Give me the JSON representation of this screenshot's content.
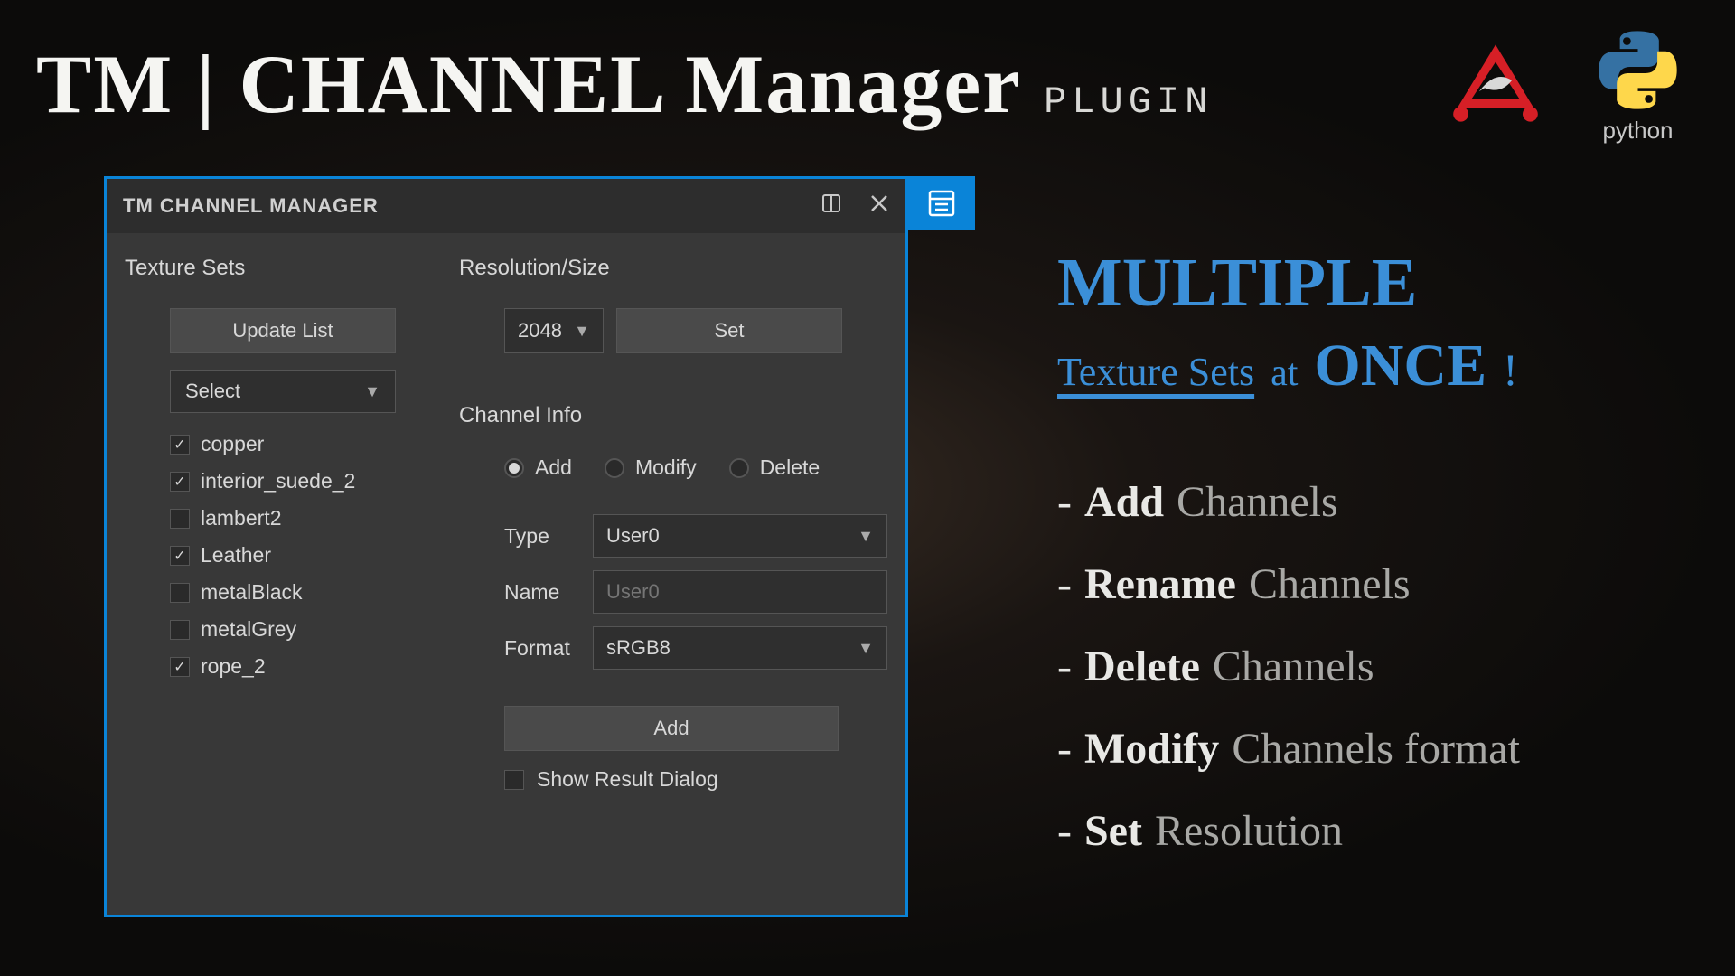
{
  "title": {
    "main": "TM | CHANNEL Manager",
    "suffix": "PLUGIN"
  },
  "logos": {
    "substance": "substance-logo",
    "python": "python"
  },
  "window": {
    "title": "TM CHANNEL MANAGER",
    "left": {
      "heading": "Texture Sets",
      "update_btn": "Update List",
      "select_placeholder": "Select",
      "items": [
        {
          "label": "copper",
          "checked": true
        },
        {
          "label": "interior_suede_2",
          "checked": true
        },
        {
          "label": "lambert2",
          "checked": false
        },
        {
          "label": "Leather",
          "checked": true
        },
        {
          "label": "metalBlack",
          "checked": false
        },
        {
          "label": "metalGrey",
          "checked": false
        },
        {
          "label": "rope_2",
          "checked": true
        }
      ]
    },
    "right": {
      "res_heading": "Resolution/Size",
      "res_value": "2048",
      "set_btn": "Set",
      "channel_heading": "Channel Info",
      "radios": {
        "add": "Add",
        "modify": "Modify",
        "delete": "Delete",
        "selected": "add"
      },
      "type_label": "Type",
      "type_value": "User0",
      "name_label": "Name",
      "name_placeholder": "User0",
      "format_label": "Format",
      "format_value": "sRGB8",
      "add_btn": "Add",
      "show_dialog": "Show Result Dialog",
      "show_dialog_checked": false
    }
  },
  "promo": {
    "heading": "MULTIPLE",
    "ts": "Texture Sets",
    "at": "at",
    "once": "ONCE",
    "excl": "!",
    "features": [
      {
        "action": "Add",
        "subject": "Channels"
      },
      {
        "action": "Rename",
        "subject": "Channels"
      },
      {
        "action": "Delete",
        "subject": "Channels"
      },
      {
        "action": "Modify",
        "subject": "Channels format"
      },
      {
        "action": "Set",
        "subject": "Resolution"
      }
    ]
  }
}
